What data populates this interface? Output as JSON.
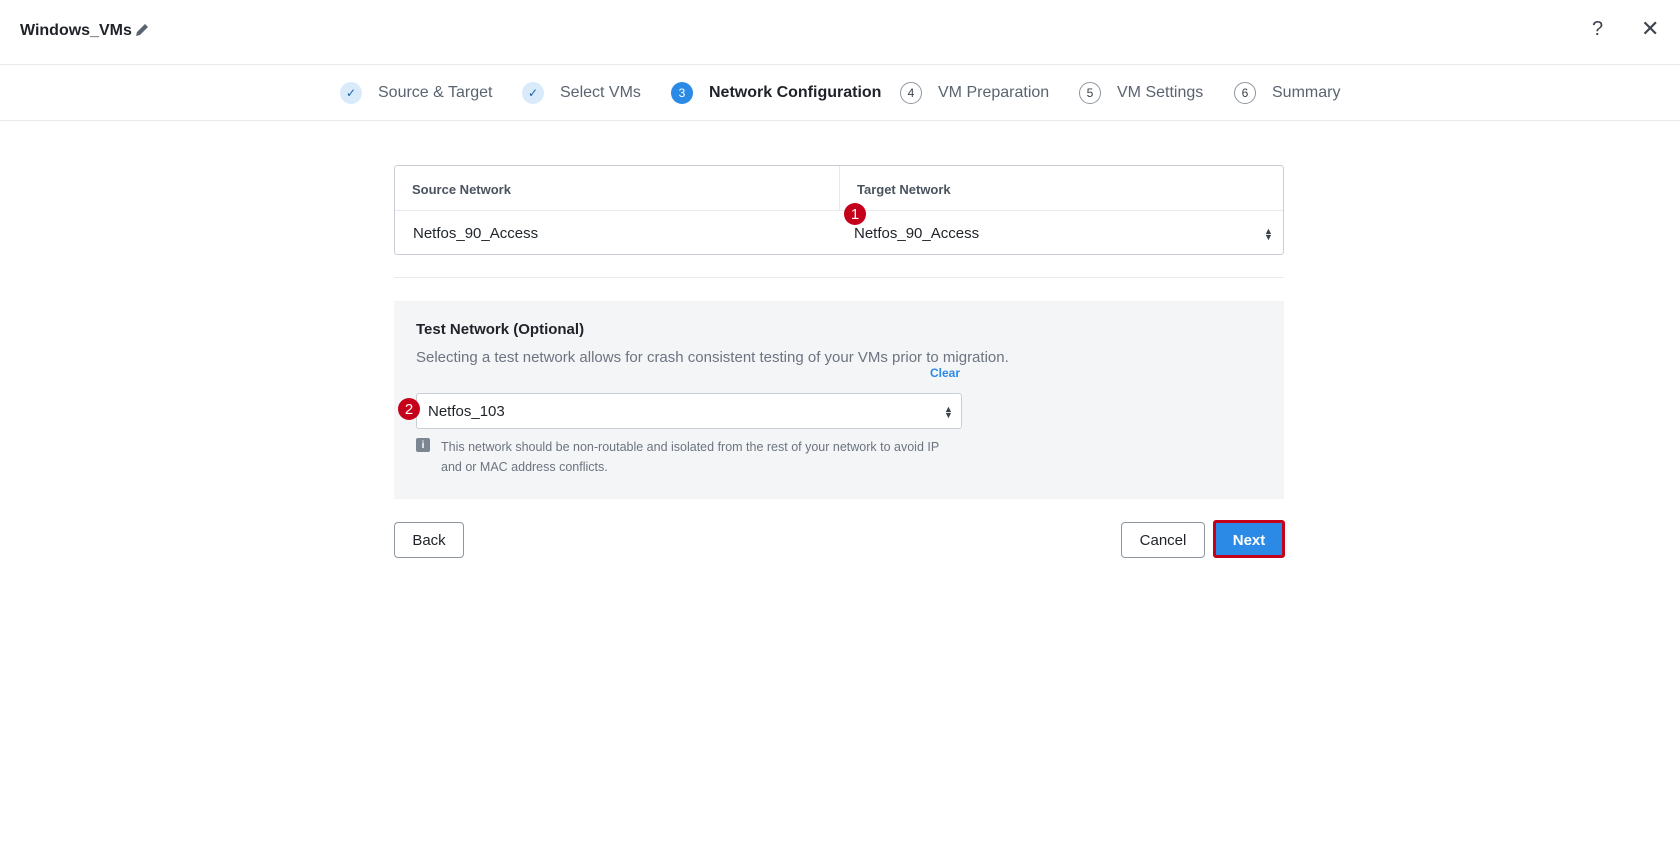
{
  "header": {
    "title": "Windows_VMs",
    "help": "?",
    "close": "✕"
  },
  "stepper": {
    "steps": [
      {
        "marker": "✓",
        "label": "Source & Target",
        "state": "completed"
      },
      {
        "marker": "✓",
        "label": "Select VMs",
        "state": "completed"
      },
      {
        "marker": "3",
        "label": "Network Configuration",
        "state": "active"
      },
      {
        "marker": "4",
        "label": "VM Preparation",
        "state": "pending"
      },
      {
        "marker": "5",
        "label": "VM Settings",
        "state": "pending"
      },
      {
        "marker": "6",
        "label": "Summary",
        "state": "pending"
      }
    ]
  },
  "mapping": {
    "source_header": "Source Network",
    "target_header": "Target Network",
    "source_value": "Netfos_90_Access",
    "target_value": "Netfos_90_Access"
  },
  "callouts": {
    "one": "1",
    "two": "2"
  },
  "test_network": {
    "title": "Test Network (Optional)",
    "description": "Selecting a test network allows for crash consistent testing of your VMs prior to migration.",
    "clear_label": "Clear",
    "selected": "Netfos_103",
    "info_icon": "info-icon",
    "info_text": "This network should be non-routable and isolated from the rest of your network to avoid IP and or MAC address conflicts."
  },
  "footer": {
    "back_label": "Back",
    "cancel_label": "Cancel",
    "next_label": "Next"
  },
  "colors": {
    "accent": "#2b8ae6",
    "callout": "#c4001a"
  }
}
